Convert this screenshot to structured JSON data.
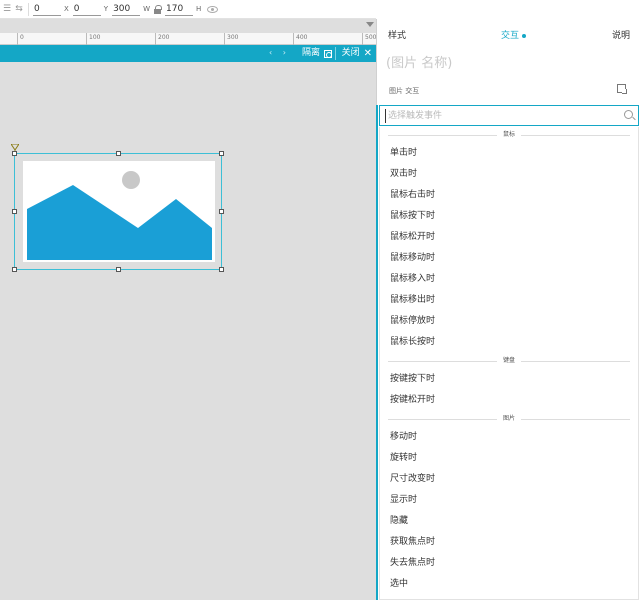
{
  "toolbar": {
    "x_value": "0",
    "x_label": "X",
    "y_value": "0",
    "y_label": "Y",
    "w_value": "300",
    "w_label": "W",
    "h_value": "170",
    "h_label": "H"
  },
  "ruler": {
    "labels": [
      "0",
      "100",
      "200",
      "300",
      "400",
      "500"
    ]
  },
  "state_bar": {
    "nav_arrows": "‹ ›",
    "hide_label": "隔离",
    "close_label": "关闭",
    "close_glyph": "✕"
  },
  "panel": {
    "tabs": [
      {
        "label": "样式"
      },
      {
        "label": "交互"
      },
      {
        "label": "说明"
      }
    ],
    "name_placeholder": "(图片 名称)",
    "section_label": "图片 交互",
    "search_placeholder": "选择触发事件",
    "groups": [
      {
        "title": "鼠标",
        "items": [
          "单击时",
          "双击时",
          "鼠标右击时",
          "鼠标按下时",
          "鼠标松开时",
          "鼠标移动时",
          "鼠标移入时",
          "鼠标移出时",
          "鼠标停放时",
          "鼠标长按时"
        ]
      },
      {
        "title": "键盘",
        "items": [
          "按键按下时",
          "按键松开时"
        ]
      },
      {
        "title": "图片",
        "items": [
          "移动时",
          "旋转时",
          "尺寸改变时",
          "显示时",
          "隐藏",
          "获取焦点时",
          "失去焦点时",
          "选中"
        ]
      }
    ]
  },
  "colors": {
    "accent": "#14a7c6",
    "image_fill": "#1a9fd6",
    "canvas_bg": "#dedede"
  }
}
